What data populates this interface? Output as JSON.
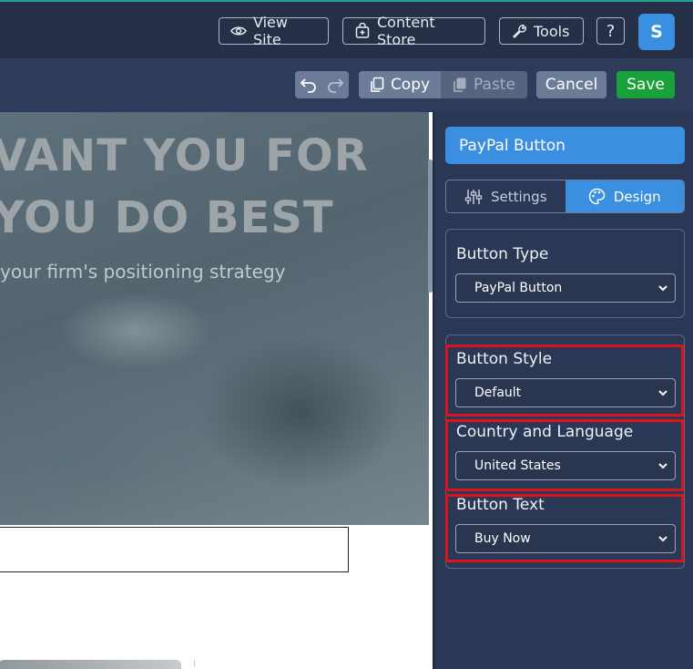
{
  "topbar": {
    "view_site": "View Site",
    "content_store": "Content Store",
    "tools": "Tools",
    "help": "?",
    "avatar_initial": "S"
  },
  "toolbar": {
    "copy": "Copy",
    "paste": "Paste",
    "cancel": "Cancel",
    "save": "Save"
  },
  "preview": {
    "headline_line1": "VANT YOU FOR",
    "headline_line2": "YOU DO BEST",
    "subheadline": "your firm's positioning strategy"
  },
  "panel": {
    "title": "PayPal Button",
    "tabs": [
      {
        "label": "Settings",
        "icon": "sliders-icon",
        "active": false
      },
      {
        "label": "Design",
        "icon": "palette-icon",
        "active": true
      }
    ],
    "fields": {
      "button_type": {
        "label": "Button Type",
        "value": "PayPal Button"
      },
      "button_style": {
        "label": "Button Style",
        "value": "Default"
      },
      "country_language": {
        "label": "Country and Language",
        "value": "United States"
      },
      "button_text": {
        "label": "Button Text",
        "value": "Buy Now"
      }
    }
  },
  "colors": {
    "topbar_bg": "#253047",
    "toolbar_bg": "#2e3c5c",
    "accent_blue": "#3a8fe0",
    "save_green": "#19a23a",
    "highlight_red": "#d9141a"
  }
}
